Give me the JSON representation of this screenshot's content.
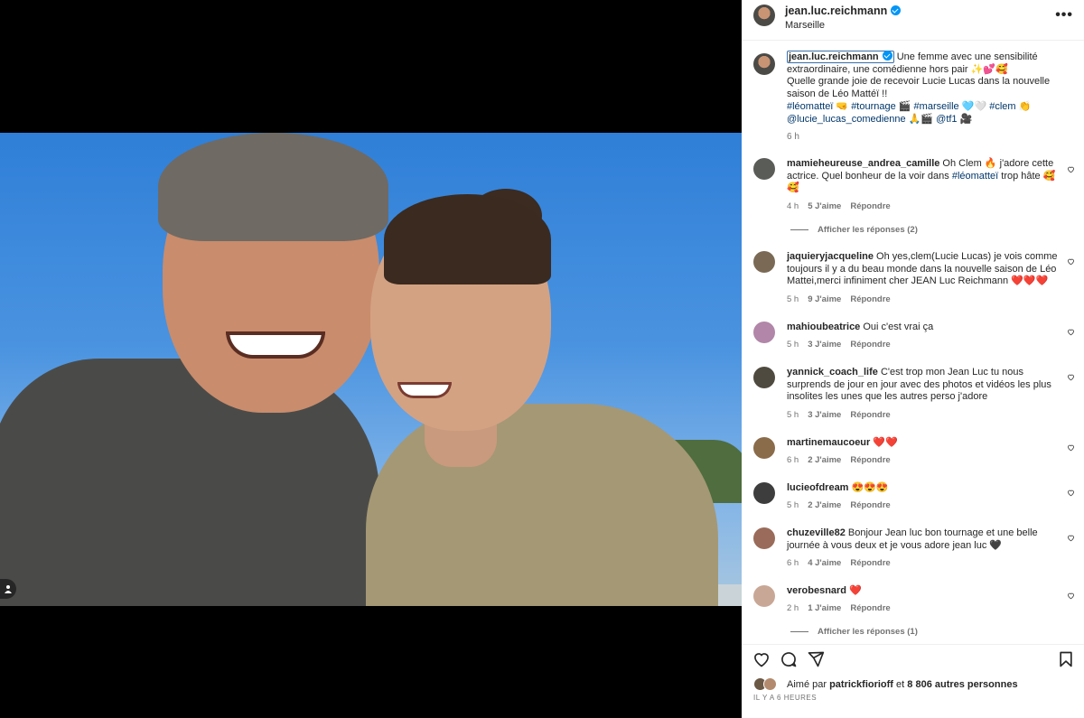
{
  "header": {
    "username": "jean.luc.reichmann",
    "location": "Marseille",
    "more": "•••"
  },
  "caption": {
    "username": "jean.luc.reichmann",
    "line1": " Une femme avec une sensibilité extraordinaire, une comédienne hors pair ✨💕🥰",
    "line2": "Quelle grande joie de recevoir Lucie Lucas dans la nouvelle saison de Léo Mattéï !!",
    "tag_leomattei": "#léomatteï",
    "emoji1": " 🤜 ",
    "tag_tournage": "#tournage",
    "emoji2": " 🎬 ",
    "tag_marseille": "#marseille",
    "emoji3": " 🩵🤍 ",
    "tag_clem": "#clem",
    "emoji4": " 👏",
    "mention_lucie": "@lucie_lucas_comedienne",
    "emoji5": " 🙏🎬 ",
    "mention_tf1": "@tf1",
    "emoji6": " 🎥",
    "time": "6 h"
  },
  "comments": [
    {
      "user": "mamieheureuse_andrea_camille",
      "text_a": " Oh Clem 🔥 j'adore cette actrice. Quel bonheur de la voir dans ",
      "tag": "#léomatteï",
      "text_b": " trop hâte 🥰🥰",
      "time": "4 h",
      "likes": "5 J'aime",
      "reply": "Répondre",
      "replies": "Afficher les réponses (2)",
      "avatar_color": "#5a5c58"
    },
    {
      "user": "jaquieryjacqueline",
      "text": " Oh yes,clem(Lucie Lucas) je vois comme toujours il y a du beau monde dans la nouvelle saison de Léo Mattei,merci infiniment cher JEAN Luc Reichmann ❤️❤️❤️",
      "time": "5 h",
      "likes": "9 J'aime",
      "reply": "Répondre",
      "avatar_color": "#7a6a55"
    },
    {
      "user": "mahioubeatrice",
      "text": " Oui c'est vrai ça",
      "time": "5 h",
      "likes": "3 J'aime",
      "reply": "Répondre",
      "avatar_color": "#b186a8"
    },
    {
      "user": "yannick_coach_life",
      "text": " C'est trop mon Jean Luc tu nous surprends de jour en jour avec des photos et vidéos les plus insolites les unes que les autres perso j'adore",
      "time": "5 h",
      "likes": "3 J'aime",
      "reply": "Répondre",
      "avatar_color": "#4e4a3f"
    },
    {
      "user": "martinemaucoeur",
      "text": " ❤️❤️",
      "time": "6 h",
      "likes": "2 J'aime",
      "reply": "Répondre",
      "avatar_color": "#8a6b4a"
    },
    {
      "user": "lucieofdream",
      "text": " 😍😍😍",
      "time": "5 h",
      "likes": "2 J'aime",
      "reply": "Répondre",
      "avatar_color": "#3d3d3d"
    },
    {
      "user": "chuzeville82",
      "text": " Bonjour Jean luc bon tournage et une belle journée à vous deux et je vous adore jean luc 🖤",
      "time": "6 h",
      "likes": "4 J'aime",
      "reply": "Répondre",
      "avatar_color": "#9a6b5a"
    },
    {
      "user": "verobesnard",
      "text": " ❤️",
      "time": "2 h",
      "likes": "1 J'aime",
      "reply": "Répondre",
      "replies": "Afficher les réponses (1)",
      "avatar_color": "#c9a796"
    }
  ],
  "footer": {
    "liked_prefix": "Aimé par ",
    "liked_user": "patrickfiorioff",
    "liked_mid": " et ",
    "liked_count": "8 806 autres personnes",
    "ago": "IL Y A 6 HEURES"
  },
  "icons": {
    "like": "heart-icon",
    "comment": "comment-icon",
    "share": "share-icon",
    "save": "bookmark-icon",
    "verified": "verified-icon",
    "tag": "user-tag-icon"
  },
  "colors": {
    "link": "#00376b",
    "verified": "#0095f6",
    "meta": "#737373"
  }
}
